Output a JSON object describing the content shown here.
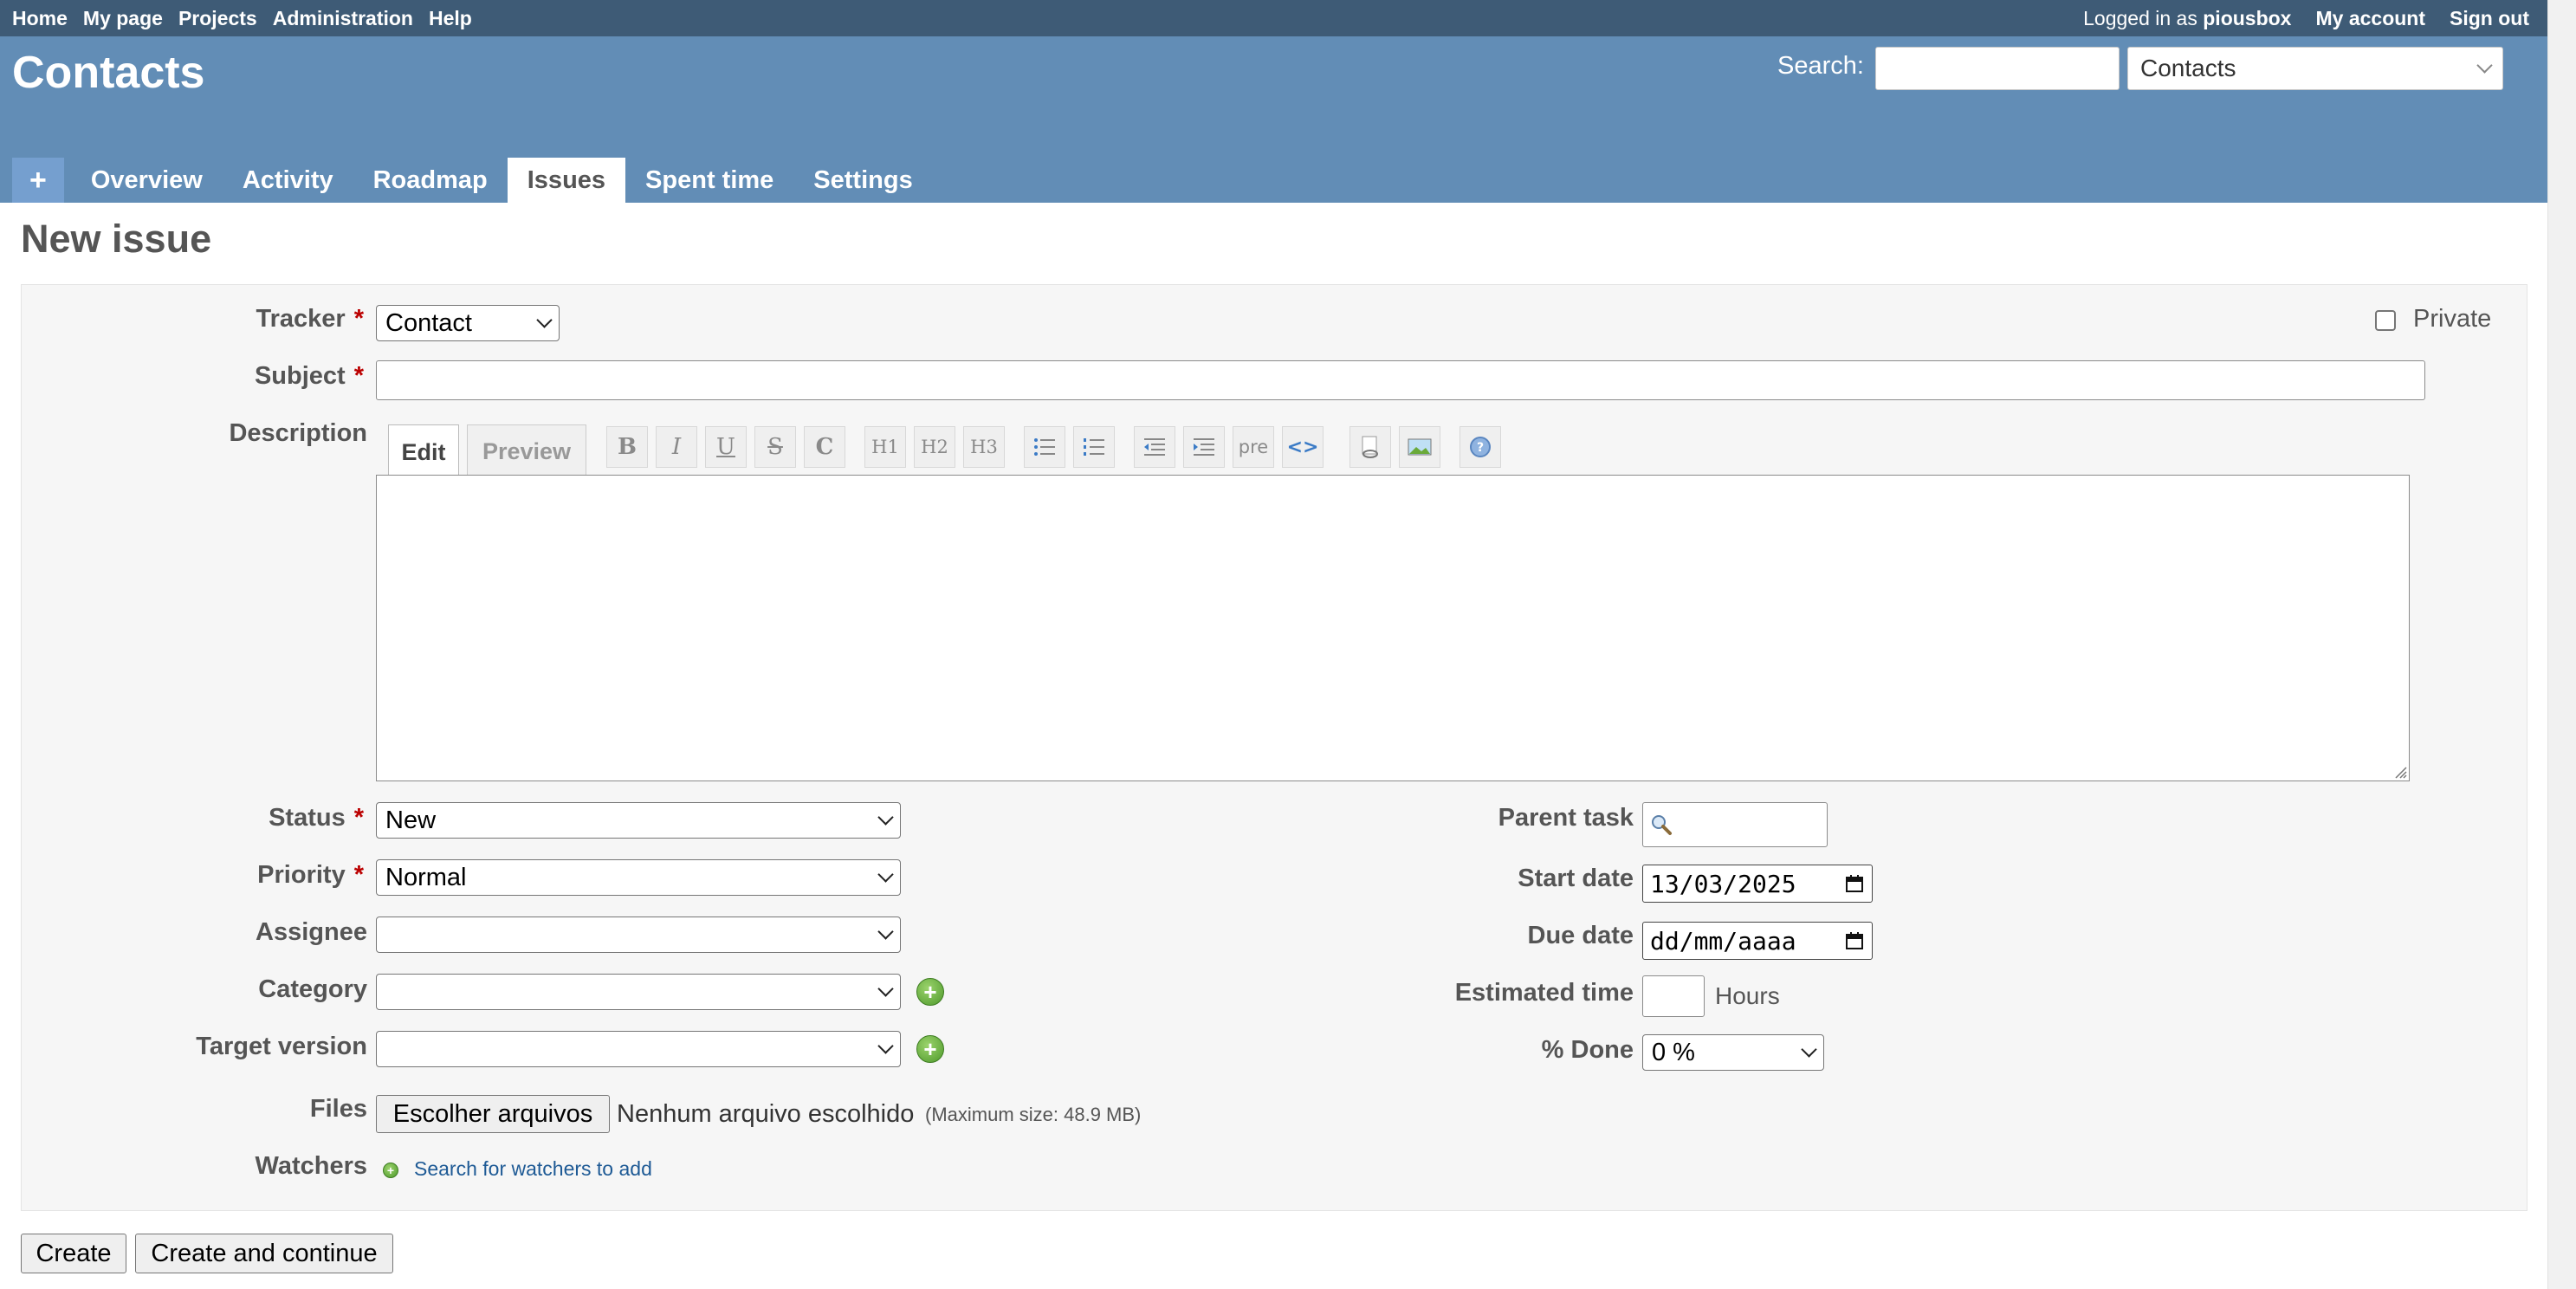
{
  "top_menu": {
    "items": [
      "Home",
      "My page",
      "Projects",
      "Administration",
      "Help"
    ],
    "logged_in_prefix": "Logged in as",
    "user": "piousbox",
    "my_account": "My account",
    "sign_out": "Sign out"
  },
  "header": {
    "project_title": "Contacts",
    "search_label": "Search:",
    "search_value": "",
    "project_jump": "Contacts"
  },
  "main_menu": {
    "new_symbol": "+",
    "tabs": [
      "Overview",
      "Activity",
      "Roadmap",
      "Issues",
      "Spent time",
      "Settings"
    ],
    "selected": "Issues"
  },
  "page_title": "New issue",
  "form": {
    "tracker": {
      "label": "Tracker",
      "value": "Contact"
    },
    "private": {
      "label": "Private",
      "checked": false
    },
    "subject": {
      "label": "Subject",
      "value": ""
    },
    "description": {
      "label": "Description",
      "tab_edit": "Edit",
      "tab_preview": "Preview",
      "toolbar": [
        "B",
        "I",
        "U",
        "S",
        "C",
        "H1",
        "H2",
        "H3",
        "ul",
        "ol",
        "indent-left",
        "indent-right",
        "pre",
        "code",
        "link",
        "image",
        "help"
      ],
      "toolbar_text": {
        "b": "B",
        "i": "I",
        "u": "U",
        "s": "S",
        "c": "C",
        "h1": "H1",
        "h2": "H2",
        "h3": "H3",
        "pre": "pre",
        "code": "<>"
      },
      "value": ""
    },
    "status": {
      "label": "Status",
      "value": "New"
    },
    "priority": {
      "label": "Priority",
      "value": "Normal"
    },
    "assignee": {
      "label": "Assignee",
      "value": ""
    },
    "category": {
      "label": "Category",
      "value": ""
    },
    "target_version": {
      "label": "Target version",
      "value": ""
    },
    "parent_task": {
      "label": "Parent task",
      "value": ""
    },
    "start_date": {
      "label": "Start date",
      "value": "13/03/2025"
    },
    "due_date": {
      "label": "Due date",
      "value": "dd/mm/aaaa"
    },
    "estimated_time": {
      "label": "Estimated time",
      "value": "",
      "unit": "Hours"
    },
    "done": {
      "label": "% Done",
      "value": "0 %"
    },
    "files": {
      "label": "Files",
      "button": "Escolher arquivos",
      "status": "Nenhum arquivo escolhido",
      "max_size": "(Maximum size: 48.9 MB)"
    },
    "watchers": {
      "label": "Watchers",
      "link": "Search for watchers to add"
    }
  },
  "buttons": {
    "create": "Create",
    "create_continue": "Create and continue"
  },
  "colors": {
    "top_menu_bg": "#3e5b76",
    "header_bg": "#628db6",
    "required": "#bb0000",
    "link": "#1e5a95"
  }
}
